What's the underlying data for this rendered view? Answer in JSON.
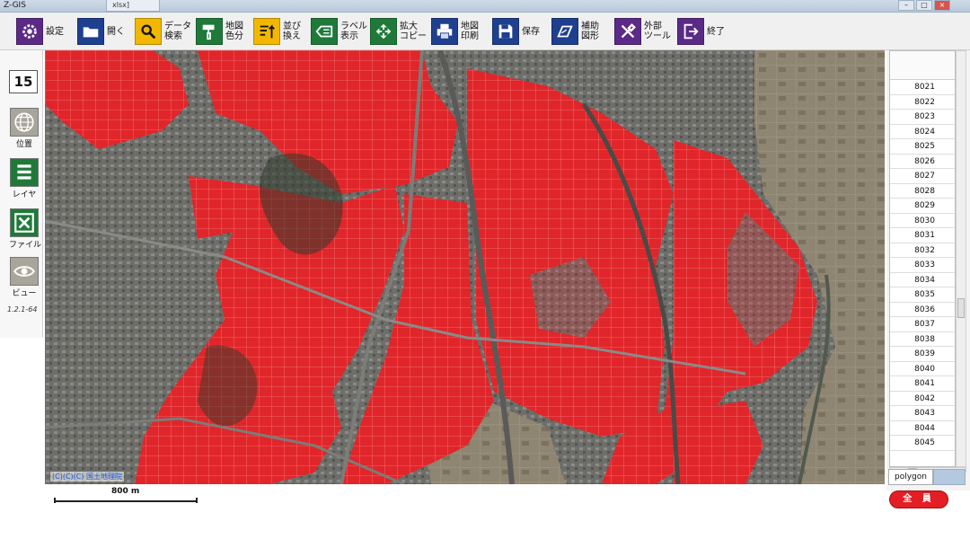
{
  "window": {
    "title": "Z-GIS",
    "file_tab": "xlsx]",
    "controls": [
      "–",
      "□",
      "×"
    ]
  },
  "toolbar": {
    "items": [
      {
        "id": "settings",
        "label": "設定",
        "icon": "gear-icon",
        "color": "#5b2a86"
      },
      {
        "id": "open",
        "label": "開く",
        "icon": "folder-icon",
        "color": "#1f3f8f"
      },
      {
        "id": "data-search",
        "label": "データ\n検索",
        "icon": "magnifier-icon",
        "color": "#f2b700"
      },
      {
        "id": "map-coloring",
        "label": "地図\n色分",
        "icon": "paint-roller-icon",
        "color": "#1f7a3a"
      },
      {
        "id": "sort",
        "label": "並び\n換え",
        "icon": "sort-icon",
        "color": "#f2b700"
      },
      {
        "id": "label-display",
        "label": "ラベル\n表示",
        "icon": "label-icon",
        "color": "#1f7a3a"
      },
      {
        "id": "enlarge-copy",
        "label": "拡大\nコピー",
        "icon": "expand-icon",
        "color": "#1f7a3a"
      },
      {
        "id": "map-print",
        "label": "地図\n印刷",
        "icon": "printer-icon",
        "color": "#1f3f8f"
      },
      {
        "id": "save",
        "label": "保存",
        "icon": "floppy-icon",
        "color": "#1f3f8f"
      },
      {
        "id": "aux-shape",
        "label": "補助\n図形",
        "icon": "shape-icon",
        "color": "#1f3f8f"
      },
      {
        "id": "external-tools",
        "label": "外部\nツール",
        "icon": "tools-icon",
        "color": "#5b2a86"
      },
      {
        "id": "exit",
        "label": "終了",
        "icon": "exit-icon",
        "color": "#5b2a86"
      }
    ]
  },
  "sidebar": {
    "zoom_level": "15",
    "buttons": [
      {
        "id": "position",
        "label": "位置",
        "icon": "globe-icon",
        "color": "#a8a59a"
      },
      {
        "id": "layer",
        "label": "レイヤ",
        "icon": "layers-icon",
        "color": "#1f7a3a"
      },
      {
        "id": "file",
        "label": "ファイル",
        "icon": "excel-icon",
        "color": "#1f7a3a"
      },
      {
        "id": "view",
        "label": "ビュー",
        "icon": "eye-icon",
        "color": "#a8a59a"
      }
    ],
    "version": "1.2.1-64"
  },
  "map": {
    "credit": "(C)(C)(C) 国土地理院",
    "highlight_color": "#e0262a"
  },
  "list": {
    "rows": [
      "8021",
      "8022",
      "8023",
      "8024",
      "8025",
      "8026",
      "8027",
      "8028",
      "8029",
      "8030",
      "8031",
      "8032",
      "8033",
      "8034",
      "8035",
      "8036",
      "8037",
      "8038",
      "8039",
      "8040",
      "8041",
      "8042",
      "8043",
      "8044",
      "8045"
    ],
    "sheet_tab": "polygon"
  },
  "scale": {
    "label": "800 m"
  },
  "badge": {
    "label": "全 員",
    "color": "#e31e24"
  }
}
